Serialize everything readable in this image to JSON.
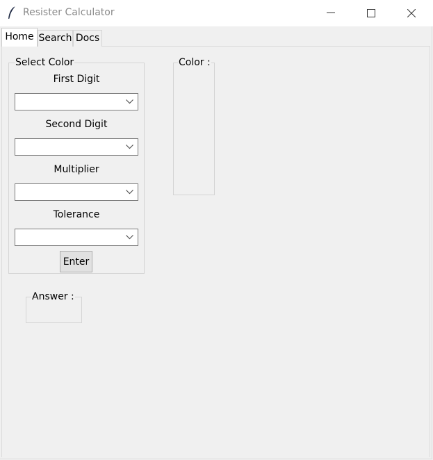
{
  "window": {
    "title": "Resister Calculator",
    "icon": "feather-icon"
  },
  "tabs": [
    {
      "label": "Home",
      "selected": true
    },
    {
      "label": "Search",
      "selected": false
    },
    {
      "label": "Docs",
      "selected": false
    }
  ],
  "select_color": {
    "title": "Select Color",
    "fields": [
      {
        "label": "First Digit",
        "value": ""
      },
      {
        "label": "Second Digit",
        "value": ""
      },
      {
        "label": "Multiplier",
        "value": ""
      },
      {
        "label": "Tolerance",
        "value": ""
      }
    ],
    "enter_label": "Enter"
  },
  "color_panel": {
    "title": "Color :"
  },
  "answer_panel": {
    "title": "Answer :"
  }
}
